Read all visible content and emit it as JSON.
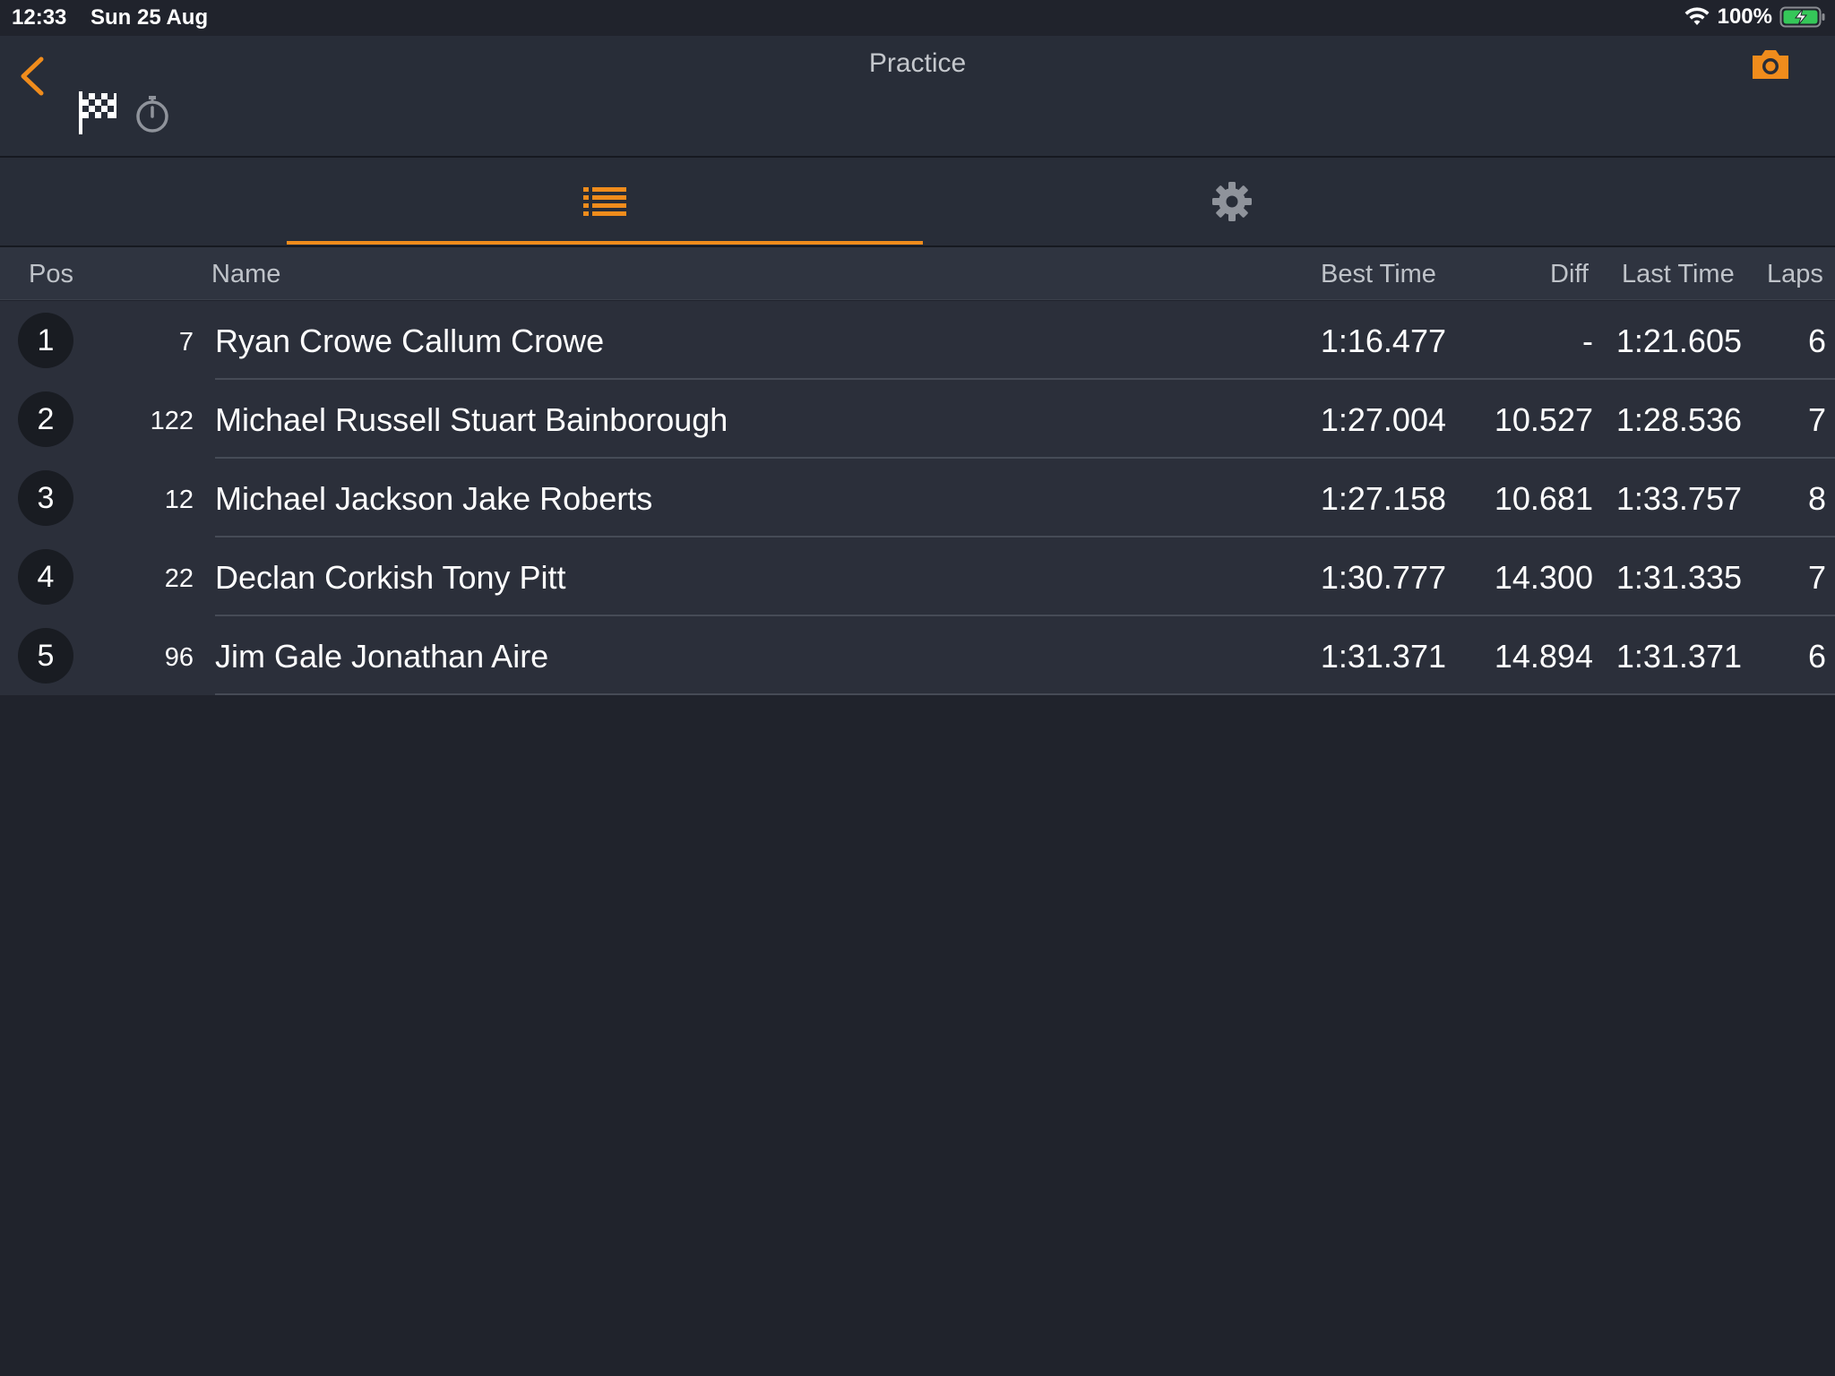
{
  "status_bar": {
    "time": "12:33",
    "date": "Sun 25 Aug",
    "battery": "100%"
  },
  "nav": {
    "title": "Practice",
    "accent_color": "#f08c1c",
    "icons": [
      "chevron-left-icon",
      "checkered-flag-icon",
      "stopwatch-icon",
      "camera-icon"
    ]
  },
  "tabs": [
    {
      "name": "list",
      "icon": "list-icon",
      "selected": true
    },
    {
      "name": "settings",
      "icon": "gear-icon",
      "selected": false
    }
  ],
  "table": {
    "headers": {
      "pos": "Pos",
      "name": "Name",
      "best": "Best Time",
      "diff": "Diff",
      "last": "Last Time",
      "laps": "Laps"
    },
    "rows": [
      {
        "pos": "1",
        "num": "7",
        "name": "Ryan Crowe Callum Crowe",
        "best": "1:16.477",
        "diff": "-",
        "last": "1:21.605",
        "laps": "6"
      },
      {
        "pos": "2",
        "num": "122",
        "name": "Michael Russell Stuart Bainborough",
        "best": "1:27.004",
        "diff": "10.527",
        "last": "1:28.536",
        "laps": "7"
      },
      {
        "pos": "3",
        "num": "12",
        "name": "Michael Jackson Jake Roberts",
        "best": "1:27.158",
        "diff": "10.681",
        "last": "1:33.757",
        "laps": "8"
      },
      {
        "pos": "4",
        "num": "22",
        "name": "Declan Corkish Tony Pitt",
        "best": "1:30.777",
        "diff": "14.300",
        "last": "1:31.335",
        "laps": "7"
      },
      {
        "pos": "5",
        "num": "96",
        "name": "Jim Gale Jonathan Aire",
        "best": "1:31.371",
        "diff": "14.894",
        "last": "1:31.371",
        "laps": "6"
      }
    ]
  }
}
